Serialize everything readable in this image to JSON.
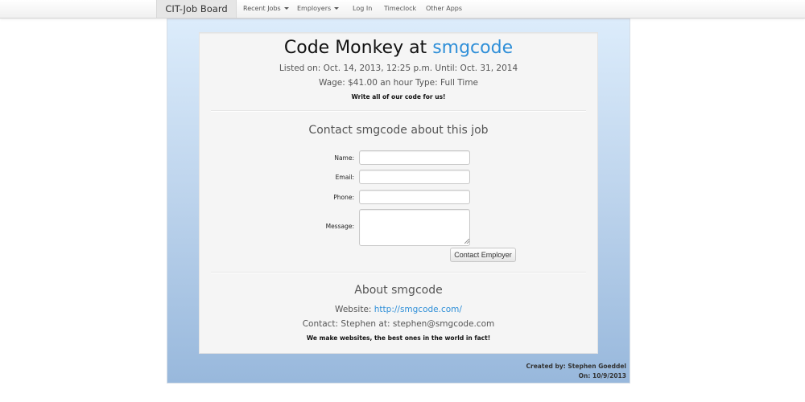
{
  "navbar": {
    "brand": "CIT-Job Board",
    "items": [
      {
        "label": "Recent Jobs",
        "dropdown": true
      },
      {
        "label": "Employers",
        "dropdown": true
      },
      {
        "label": "Log In",
        "dropdown": false
      },
      {
        "label": "Timeclock",
        "dropdown": false
      },
      {
        "label": "Other Apps",
        "dropdown": false
      }
    ]
  },
  "job": {
    "title_prefix": "Code Monkey at ",
    "company": "smgcode",
    "listed_on": "Listed on: Oct. 14, 2013, 12:25 p.m. Until: Oct. 31, 2014",
    "wage_line": "Wage: $41.00 an hour Type: Full Time",
    "description": "Write all of our code for us!"
  },
  "contact_form": {
    "heading": "Contact smgcode about this job",
    "fields": [
      {
        "label": "Name:",
        "value": ""
      },
      {
        "label": "Email:",
        "value": ""
      },
      {
        "label": "Phone:",
        "value": ""
      },
      {
        "label": "Message:",
        "value": ""
      }
    ],
    "submit_label": "Contact Employer"
  },
  "about": {
    "heading": "About smgcode",
    "website_label": "Website: ",
    "website_url": "http://smgcode.com/",
    "contact": "Contact: Stephen at: stephen@smgcode.com",
    "tagline": "We make websites, the best ones in the world in fact!"
  },
  "footer": {
    "created_by": "Created by: Stephen Goeddel",
    "created_on": "On: 10/9/2013"
  },
  "colors": {
    "link": "#2f8fd8",
    "panel_top": "#dcecfb",
    "panel_bottom": "#98b8dc"
  }
}
